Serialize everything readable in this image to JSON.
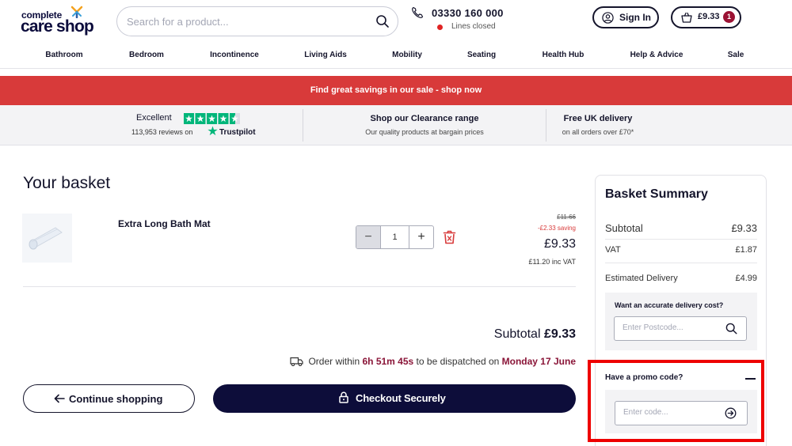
{
  "header": {
    "logo_top": "complete",
    "logo_bottom": "care shop",
    "search_placeholder": "Search for a product...",
    "phone_number": "03330 160 000",
    "phone_status": "Lines closed",
    "signin_label": "Sign In",
    "basket_amount": "£9.33",
    "basket_count": "1"
  },
  "nav": {
    "items": [
      "Bathroom",
      "Bedroom",
      "Incontinence",
      "Living Aids",
      "Mobility",
      "Seating",
      "Health Hub",
      "Help & Advice",
      "Sale"
    ]
  },
  "sale_banner": "Find great savings in our sale - shop now",
  "usp": {
    "trustpilot_rating": "Excellent",
    "trustpilot_reviews": "113,953 reviews on",
    "trustpilot_brand": "Trustpilot",
    "clearance_title": "Shop our Clearance range",
    "clearance_sub": "Our quality products at bargain prices",
    "delivery_title": "Free UK delivery",
    "delivery_sub": "on all orders over £70*"
  },
  "basket": {
    "title": "Your basket",
    "item": {
      "name": "Extra Long Bath Mat",
      "quantity": "1",
      "was_price": "£11.66",
      "saving": "-£2.33 saving",
      "price": "£9.33",
      "inc_vat": "£11.20 inc VAT"
    },
    "subtotal_label": "Subtotal",
    "subtotal_value": "£9.33",
    "dispatch_pre": "Order within",
    "dispatch_time": "6h 51m 45s",
    "dispatch_mid": "to be dispatched on",
    "dispatch_date": "Monday 17 June",
    "continue_label": "Continue shopping",
    "checkout_label": "Checkout Securely"
  },
  "summary": {
    "title": "Basket Summary",
    "subtotal_label": "Subtotal",
    "subtotal_value": "£9.33",
    "vat_label": "VAT",
    "vat_value": "£1.87",
    "delivery_label": "Estimated Delivery",
    "delivery_value": "£4.99",
    "postcode_question": "Want an accurate delivery cost?",
    "postcode_placeholder": "Enter Postcode...",
    "promo_title": "Have a promo code?",
    "promo_placeholder": "Enter code..."
  },
  "colors": {
    "navy": "#0d0d3a",
    "sale_red": "#d83a3a",
    "accent_maroon": "#8a1538",
    "trustpilot_green": "#00b67a",
    "highlight_red": "#ee0000"
  }
}
